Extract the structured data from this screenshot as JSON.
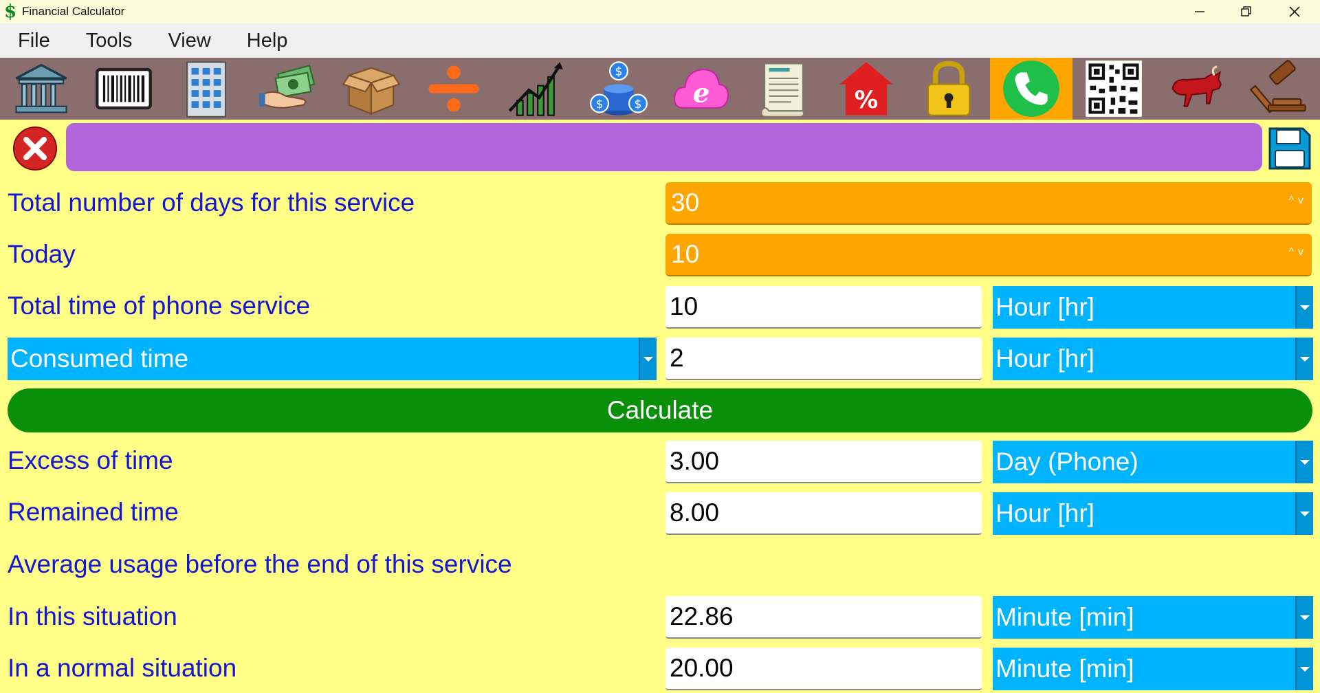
{
  "window": {
    "title": "Financial Calculator",
    "app_icon": "$"
  },
  "menu": [
    "File",
    "Tools",
    "View",
    "Help"
  ],
  "toolbar": {
    "icons": [
      "bank-icon",
      "barcode-icon",
      "building-icon",
      "money-hand-icon",
      "box-icon",
      "divide-icon",
      "growth-chart-icon",
      "coins-icon",
      "cloud-browser-icon",
      "receipt-icon",
      "house-percent-icon",
      "lock-icon",
      "phone-icon",
      "qr-code-icon",
      "bull-icon",
      "gavel-icon"
    ],
    "active": "phone-icon",
    "active_color": "#ffa500"
  },
  "form": {
    "days_label": "Total number of days for this service",
    "days_value": "30",
    "today_label": "Today",
    "today_value": "10",
    "total_time_label": "Total time of phone service",
    "total_time_value": "10",
    "total_time_unit": "Hour [hr]",
    "consumed_selector": "Consumed time",
    "consumed_value": "2",
    "consumed_unit": "Hour [hr]",
    "calculate_label": "Calculate",
    "excess_label": "Excess of time",
    "excess_value": "3.00",
    "excess_unit": "Day (Phone)",
    "remained_label": "Remained time",
    "remained_value": "8.00",
    "remained_unit": "Hour [hr]",
    "average_heading": "Average usage before the end of this service",
    "situation_label": "In this situation",
    "situation_value": "22.86",
    "situation_unit": "Minute [min]",
    "normal_label": "In a normal situation",
    "normal_value": "20.00",
    "normal_unit": "Minute [min]"
  },
  "colors": {
    "background": "#ffff88",
    "label": "#1515d6",
    "orange": "#ffa500",
    "blue": "#00b3ff",
    "green": "#0a8f0a",
    "purple": "#b264db"
  }
}
